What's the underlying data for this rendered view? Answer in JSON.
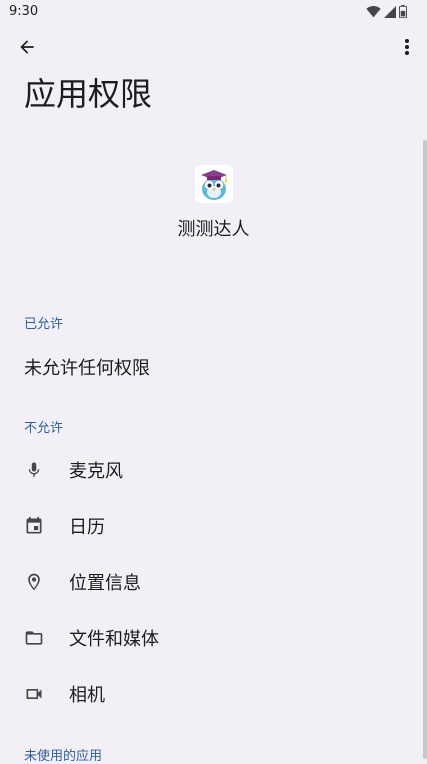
{
  "status_bar": {
    "time": "9:30",
    "icons": [
      "wifi-icon",
      "cellular-signal-icon",
      "battery-icon"
    ]
  },
  "toolbar": {
    "back_icon": "arrow-back-icon",
    "more_icon": "more-vertical-icon"
  },
  "page": {
    "title": "应用权限"
  },
  "app": {
    "name": "测测达人",
    "icon": "owl-graduate-app-icon"
  },
  "sections": {
    "allowed": {
      "header": "已允许",
      "empty_text": "未允许任何权限"
    },
    "denied": {
      "header": "不允许",
      "items": [
        {
          "label": "麦克风",
          "icon": "microphone-icon"
        },
        {
          "label": "日历",
          "icon": "calendar-icon"
        },
        {
          "label": "位置信息",
          "icon": "location-icon"
        },
        {
          "label": "文件和媒体",
          "icon": "folder-icon"
        },
        {
          "label": "相机",
          "icon": "videocam-icon"
        }
      ]
    },
    "unused": {
      "header": "未使用的应用"
    }
  },
  "colors": {
    "background": "#f2f0f6",
    "section_header": "#2f5e9e",
    "text_primary": "#1c1b1f",
    "icon": "#444746"
  }
}
